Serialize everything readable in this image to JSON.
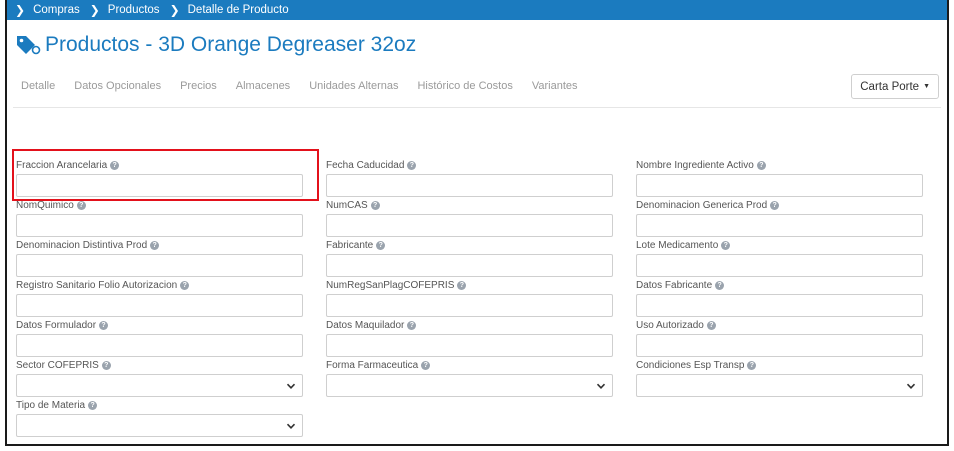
{
  "breadcrumb": {
    "items": [
      "Compras",
      "Productos",
      "Detalle de Producto"
    ]
  },
  "page": {
    "title": "Productos - 3D Orange Degreaser 32oz"
  },
  "tabs": [
    "Detalle",
    "Datos Opcionales",
    "Precios",
    "Almacenes",
    "Unidades Alternas",
    "Histórico de Costos",
    "Variantes"
  ],
  "carta_porte": {
    "label": "Carta Porte"
  },
  "fields": {
    "fraccion_arancelaria": "Fraccion Arancelaria",
    "fecha_caducidad": "Fecha Caducidad",
    "nombre_ingrediente_activo": "Nombre Ingrediente Activo",
    "nom_quimico": "NomQuimico",
    "num_cas": "NumCAS",
    "denominacion_generica_prod": "Denominacion Generica Prod",
    "denominacion_distintiva_prod": "Denominacion Distintiva Prod",
    "fabricante": "Fabricante",
    "lote_medicamento": "Lote Medicamento",
    "registro_sanitario_folio": "Registro Sanitario Folio Autorizacion",
    "num_reg_san_plag": "NumRegSanPlagCOFEPRIS",
    "datos_fabricante": "Datos Fabricante",
    "datos_formulador": "Datos Formulador",
    "datos_maquilador": "Datos Maquilador",
    "uso_autorizado": "Uso Autorizado",
    "sector_cofepris": "Sector COFEPRIS",
    "forma_farmaceutica": "Forma Farmaceutica",
    "condiciones_esp_transp": "Condiciones Esp Transp",
    "tipo_de_materia": "Tipo de Materia"
  },
  "colors": {
    "brand": "#1b7bbf",
    "highlight": "#e3111b"
  },
  "icons": {
    "breadcrumb_separator": "chevron-right-icon",
    "title": "price-tag-icon",
    "help": "question-circle-icon",
    "select": "chevron-down-icon"
  }
}
